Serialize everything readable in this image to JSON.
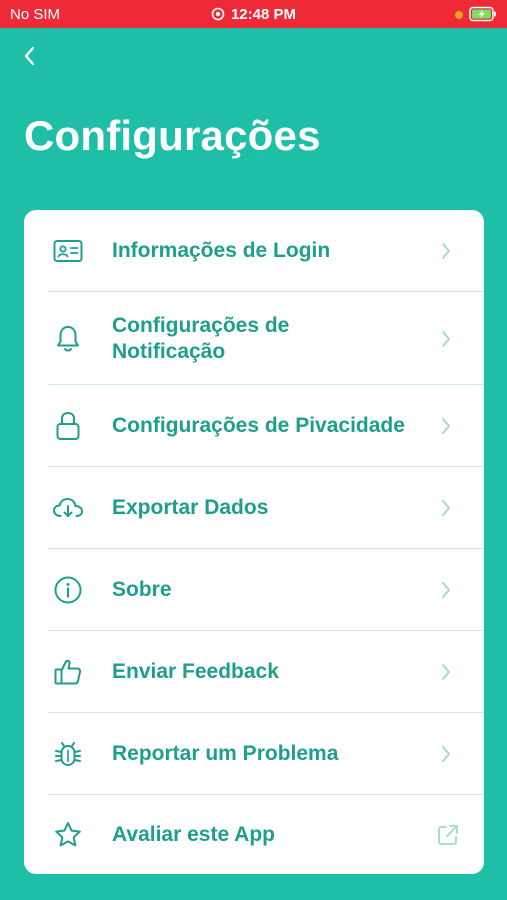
{
  "status_bar": {
    "carrier": "No SIM",
    "time": "12:48 PM",
    "alarm_icon": "alarm-icon",
    "dot_color": "#ffa21a",
    "battery_icon": "battery-charging-icon",
    "background_color": "#ee2a38"
  },
  "header": {
    "back_icon": "chevron-left-icon",
    "title": "Configurações"
  },
  "colors": {
    "background": "#1fbfa7",
    "accent": "#1e9f8d",
    "card": "#ffffff",
    "chevron": "#9fd9cf",
    "separator": "#cfe9e3"
  },
  "menu": {
    "items": [
      {
        "label": "Informações de Login",
        "icon": "id-card-icon",
        "trailing": "chevron-right-icon"
      },
      {
        "label": "Configurações de\nNotificação",
        "icon": "bell-icon",
        "trailing": "chevron-right-icon"
      },
      {
        "label": "Configurações de Pivacidade",
        "icon": "lock-icon",
        "trailing": "chevron-right-icon"
      },
      {
        "label": "Exportar Dados",
        "icon": "cloud-download-icon",
        "trailing": "chevron-right-icon"
      },
      {
        "label": "Sobre",
        "icon": "info-icon",
        "trailing": "chevron-right-icon"
      },
      {
        "label": "Enviar Feedback",
        "icon": "thumbs-up-icon",
        "trailing": "chevron-right-icon"
      },
      {
        "label": "Reportar um Problema",
        "icon": "bug-icon",
        "trailing": "chevron-right-icon"
      },
      {
        "label": "Avaliar este App",
        "icon": "star-icon",
        "trailing": "external-link-icon"
      }
    ]
  }
}
